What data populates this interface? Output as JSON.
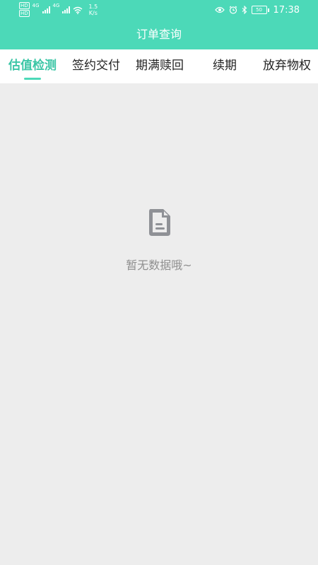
{
  "status_bar": {
    "hd1": "HD",
    "hd2": "HD",
    "net1": "4G",
    "net2": "4G",
    "speed_value": "1.5",
    "speed_unit": "K/s",
    "battery": "50",
    "time": "17:38"
  },
  "header": {
    "title": "订单查询"
  },
  "tabs": [
    {
      "label": "估值检测",
      "active": true
    },
    {
      "label": "签约交付",
      "active": false
    },
    {
      "label": "期满赎回",
      "active": false
    },
    {
      "label": "续期",
      "active": false
    },
    {
      "label": "放弃物权",
      "active": false
    }
  ],
  "empty_state": {
    "icon": "document-icon",
    "message": "暂无数据哦~"
  },
  "colors": {
    "primary": "#4cd9b8",
    "active_tab": "#3cc6a6",
    "background": "#ededed",
    "empty_text": "#8f8f8f"
  }
}
